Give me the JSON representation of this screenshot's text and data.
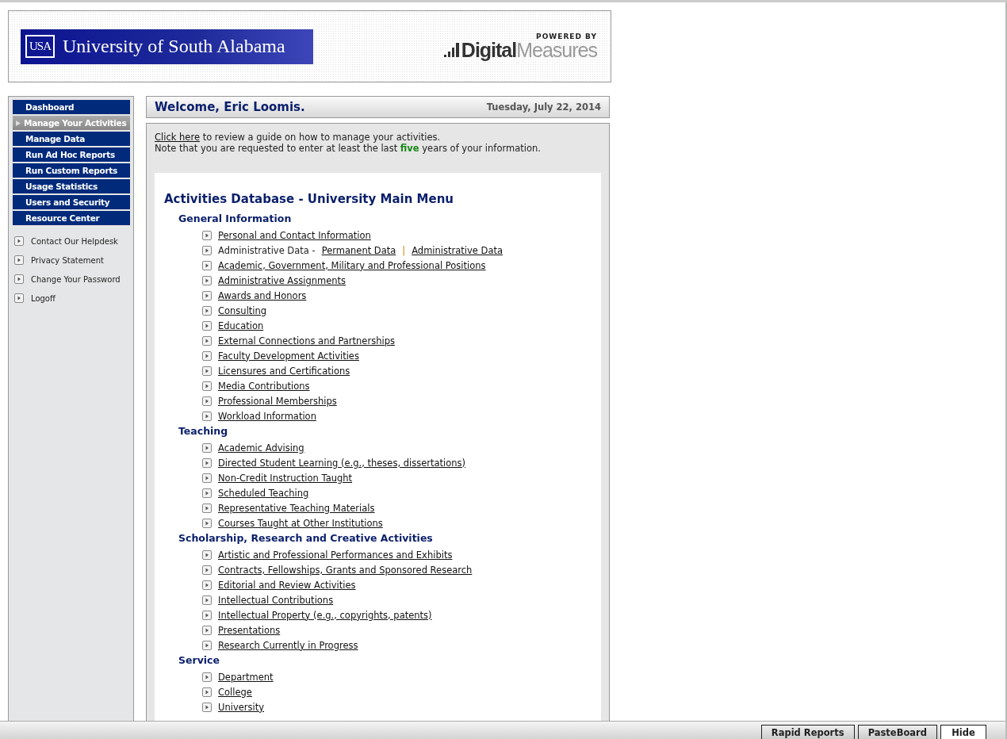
{
  "header": {
    "logo_mark": "USA",
    "logo_text": "University of South Alabama",
    "powered_by": "POWERED BY",
    "brand_first": "Digital",
    "brand_second": "Measures"
  },
  "nav": [
    {
      "label": "Dashboard",
      "selected": false
    },
    {
      "label": "Manage Your Activities",
      "selected": true
    },
    {
      "label": "Manage Data",
      "selected": false
    },
    {
      "label": "Run Ad Hoc Reports",
      "selected": false
    },
    {
      "label": "Run Custom Reports",
      "selected": false
    },
    {
      "label": "Usage Statistics",
      "selected": false
    },
    {
      "label": "Users and Security",
      "selected": false
    },
    {
      "label": "Resource Center",
      "selected": false
    }
  ],
  "side_links": [
    "Contact Our Helpdesk",
    "Privacy Statement",
    "Change Your Password",
    "Logoff"
  ],
  "welcome": "Welcome, Eric Loomis.",
  "date": "Tuesday, July 22, 2014",
  "intro": {
    "link": "Click here",
    "rest": "to review a guide on how to manage your activities.",
    "note_before": "Note that you are requested to enter at least the last",
    "note_highlight": "five",
    "note_after": "years of your information."
  },
  "menu_title": "Activities Database - University Main Menu",
  "sections": [
    {
      "title": "General Information",
      "items": [
        {
          "kind": "link",
          "label": "Personal and Contact Information"
        },
        {
          "kind": "split",
          "label": "Administrative Data -",
          "links": [
            "Permanent Data",
            "Administrative Data"
          ],
          "separator": "|"
        },
        {
          "kind": "link",
          "label": "Academic, Government, Military and Professional Positions"
        },
        {
          "kind": "link",
          "label": "Administrative Assignments"
        },
        {
          "kind": "link",
          "label": "Awards and Honors"
        },
        {
          "kind": "link",
          "label": "Consulting"
        },
        {
          "kind": "link",
          "label": "Education"
        },
        {
          "kind": "link",
          "label": "External Connections and Partnerships"
        },
        {
          "kind": "link",
          "label": "Faculty Development Activities"
        },
        {
          "kind": "link",
          "label": "Licensures and Certifications"
        },
        {
          "kind": "link",
          "label": "Media Contributions"
        },
        {
          "kind": "link",
          "label": "Professional Memberships"
        },
        {
          "kind": "link",
          "label": "Workload Information"
        }
      ]
    },
    {
      "title": "Teaching",
      "items": [
        {
          "kind": "link",
          "label": "Academic Advising"
        },
        {
          "kind": "link",
          "label": "Directed Student Learning (e.g., theses, dissertations)"
        },
        {
          "kind": "link",
          "label": "Non-Credit Instruction Taught"
        },
        {
          "kind": "link",
          "label": "Scheduled Teaching"
        },
        {
          "kind": "link",
          "label": "Representative Teaching Materials"
        },
        {
          "kind": "link",
          "label": "Courses Taught at Other Institutions"
        }
      ]
    },
    {
      "title": "Scholarship, Research and Creative Activities",
      "items": [
        {
          "kind": "link",
          "label": "Artistic and Professional Performances and Exhibits"
        },
        {
          "kind": "link",
          "label": "Contracts, Fellowships, Grants and Sponsored Research"
        },
        {
          "kind": "link",
          "label": "Editorial and Review Activities"
        },
        {
          "kind": "link",
          "label": "Intellectual Contributions"
        },
        {
          "kind": "link",
          "label": "Intellectual Property (e.g., copyrights, patents)"
        },
        {
          "kind": "link",
          "label": "Presentations"
        },
        {
          "kind": "link",
          "label": "Research Currently in Progress"
        }
      ]
    },
    {
      "title": "Service",
      "items": [
        {
          "kind": "link",
          "label": "Department"
        },
        {
          "kind": "link",
          "label": "College"
        },
        {
          "kind": "link",
          "label": "University"
        }
      ]
    }
  ],
  "bottom_buttons": [
    {
      "label": "Rapid Reports",
      "selected": false
    },
    {
      "label": "PasteBoard",
      "selected": false
    },
    {
      "label": "Hide",
      "selected": true
    }
  ]
}
